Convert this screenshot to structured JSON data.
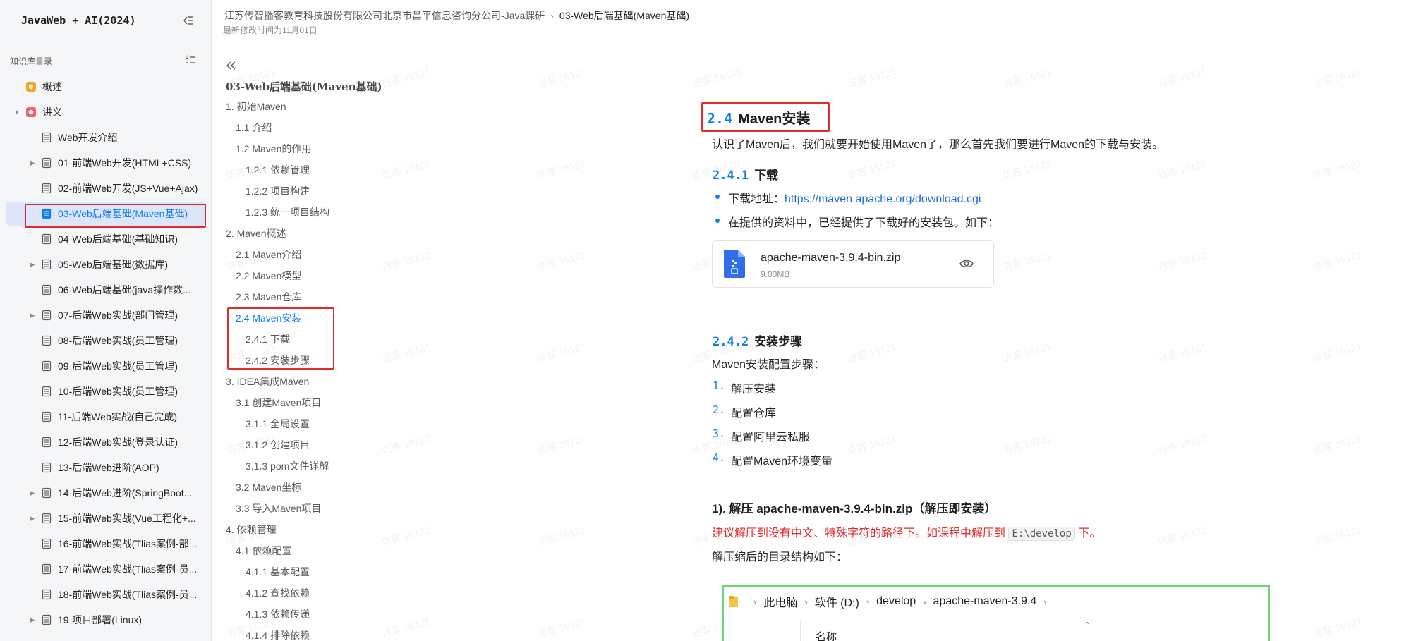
{
  "sidebar": {
    "brand": "JavaWeb + AI(2024)",
    "toc_label": "知识库目录",
    "items": [
      {
        "label": "概述",
        "level": 0,
        "icon": "overview-icon",
        "caret": ""
      },
      {
        "label": "讲义",
        "level": 0,
        "icon": "handout-icon",
        "caret": "▼"
      },
      {
        "label": "Web开发介绍",
        "level": 1,
        "icon": "doc-icon",
        "caret": ""
      },
      {
        "label": "01-前端Web开发(HTML+CSS)",
        "level": 1,
        "icon": "doc-icon",
        "caret": "▶"
      },
      {
        "label": "02-前端Web开发(JS+Vue+Ajax)",
        "level": 1,
        "icon": "doc-icon",
        "caret": ""
      },
      {
        "label": "03-Web后端基础(Maven基础)",
        "level": 1,
        "icon": "doc-icon",
        "caret": "",
        "active": true
      },
      {
        "label": "04-Web后端基础(基础知识)",
        "level": 1,
        "icon": "doc-icon",
        "caret": ""
      },
      {
        "label": "05-Web后端基础(数据库)",
        "level": 1,
        "icon": "doc-icon",
        "caret": "▶"
      },
      {
        "label": "06-Web后端基础(java操作数...",
        "level": 1,
        "icon": "doc-icon",
        "caret": ""
      },
      {
        "label": "07-后端Web实战(部门管理)",
        "level": 1,
        "icon": "doc-icon",
        "caret": "▶"
      },
      {
        "label": "08-后端Web实战(员工管理)",
        "level": 1,
        "icon": "doc-icon",
        "caret": ""
      },
      {
        "label": "09-后端Web实战(员工管理)",
        "level": 1,
        "icon": "doc-icon",
        "caret": ""
      },
      {
        "label": "10-后端Web实战(员工管理)",
        "level": 1,
        "icon": "doc-icon",
        "caret": ""
      },
      {
        "label": "11-后端Web实战(自己完成)",
        "level": 1,
        "icon": "doc-icon",
        "caret": ""
      },
      {
        "label": "12-后端Web实战(登录认证)",
        "level": 1,
        "icon": "doc-icon",
        "caret": ""
      },
      {
        "label": "13-后端Web进阶(AOP)",
        "level": 1,
        "icon": "doc-icon",
        "caret": ""
      },
      {
        "label": "14-后端Web进阶(SpringBoot...",
        "level": 1,
        "icon": "doc-icon",
        "caret": "▶"
      },
      {
        "label": "15-前端Web实战(Vue工程化+...",
        "level": 1,
        "icon": "doc-icon",
        "caret": "▶"
      },
      {
        "label": "16-前端Web实战(Tlias案例-部...",
        "level": 1,
        "icon": "doc-icon",
        "caret": ""
      },
      {
        "label": "17-前端Web实战(Tlias案例-员...",
        "level": 1,
        "icon": "doc-icon",
        "caret": ""
      },
      {
        "label": "18-前端Web实战(Tlias案例-员...",
        "level": 1,
        "icon": "doc-icon",
        "caret": ""
      },
      {
        "label": "19-项目部署(Linux)",
        "level": 1,
        "icon": "doc-icon",
        "caret": "▶"
      }
    ]
  },
  "header": {
    "crumb_parent": "江苏传智播客教育科技股份有限公司北京市昌平信息咨询分公司-Java课研",
    "crumb_separator": "›",
    "crumb_current": "03-Web后端基础(Maven基础)",
    "modified": "最新修改时间为11月01日"
  },
  "outline": {
    "title": "03-Web后端基础(Maven基础)",
    "items": [
      {
        "label": "1. 初始Maven",
        "level": 1
      },
      {
        "label": "1.1 介绍",
        "level": 2
      },
      {
        "label": "1.2 Maven的作用",
        "level": 2
      },
      {
        "label": "1.2.1 依赖管理",
        "level": 3
      },
      {
        "label": "1.2.2 项目构建",
        "level": 3
      },
      {
        "label": "1.2.3 统一项目结构",
        "level": 3
      },
      {
        "label": "2. Maven概述",
        "level": 1
      },
      {
        "label": "2.1 Maven介绍",
        "level": 2
      },
      {
        "label": "2.2 Maven模型",
        "level": 2
      },
      {
        "label": "2.3 Maven仓库",
        "level": 2
      },
      {
        "label": "2.4 Maven安装",
        "level": 2,
        "active": true
      },
      {
        "label": "2.4.1 下载",
        "level": 3
      },
      {
        "label": "2.4.2 安装步骤",
        "level": 3
      },
      {
        "label": "3. IDEA集成Maven",
        "level": 1
      },
      {
        "label": "3.1 创建Maven项目",
        "level": 2
      },
      {
        "label": "3.1.1 全局设置",
        "level": 3
      },
      {
        "label": "3.1.2 创建项目",
        "level": 3
      },
      {
        "label": "3.1.3 pom文件详解",
        "level": 3
      },
      {
        "label": "3.2 Maven坐标",
        "level": 2
      },
      {
        "label": "3.3 导入Maven项目",
        "level": 2
      },
      {
        "label": "4. 依赖管理",
        "level": 1
      },
      {
        "label": "4.1 依赖配置",
        "level": 2
      },
      {
        "label": "4.1.1 基本配置",
        "level": 3
      },
      {
        "label": "4.1.2 查找依赖",
        "level": 3
      },
      {
        "label": "4.1.3 依赖传递",
        "level": 3
      },
      {
        "label": "4.1.4 排除依赖",
        "level": 3
      }
    ]
  },
  "content": {
    "h2_num": "2.4",
    "h2_text": "Maven安装",
    "intro": "认识了Maven后，我们就要开始使用Maven了，那么首先我们要进行Maven的下载与安装。",
    "h3_download_num": "2.4.1",
    "h3_download_text": "下载",
    "bullet1_prefix": "下载地址：",
    "bullet1_link": "https://maven.apache.org/download.cgi",
    "bullet2": "在提供的资料中，已经提供了下载好的安装包。如下：",
    "file_name": "apache-maven-3.9.4-bin.zip",
    "file_size": "9.00MB",
    "h3_steps_num": "2.4.2",
    "h3_steps_text": "安装步骤",
    "steps_intro": "Maven安装配置步骤：",
    "steps": [
      {
        "num": "1.",
        "text": "解压安装"
      },
      {
        "num": "2.",
        "text": "配置仓库"
      },
      {
        "num": "3.",
        "text": "配置阿里云私服"
      },
      {
        "num": "4.",
        "text": "配置Maven环境变量"
      }
    ],
    "h4_unzip": "1). 解压 apache-maven-3.9.4-bin.zip（解压即安装）",
    "warn_prefix": "建议解压到没有中文、特殊字符的路径下。如课程中解压到",
    "warn_code": "E:\\develop",
    "warn_suffix": "下。",
    "dir_intro": "解压缩后的目录结构如下：",
    "explorer": {
      "path": [
        "此电脑",
        "软件 (D:)",
        "develop",
        "apache-maven-3.9.4"
      ],
      "column_name": "名称"
    }
  },
  "watermark": "访客 16121",
  "colors": {
    "accent": "#117cee",
    "highlight": "#e22c2c",
    "active_bg": "#dbe6fb"
  }
}
